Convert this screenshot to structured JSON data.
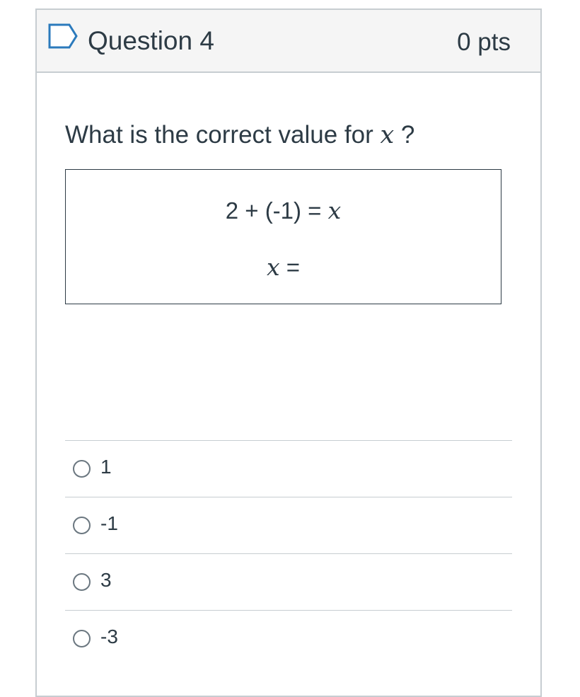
{
  "question": {
    "title": "Question 4",
    "points": "0 pts",
    "prompt_prefix": "What is the correct value for ",
    "prompt_variable": "x",
    "prompt_suffix": " ?",
    "equation_left": "2 + (-1) = ",
    "equation_variable": "x",
    "answer_variable": "x",
    "answer_equals": " ="
  },
  "answers": [
    {
      "label": "1"
    },
    {
      "label": "-1"
    },
    {
      "label": "3"
    },
    {
      "label": "-3"
    }
  ],
  "colors": {
    "text": "#2d3b45",
    "header_background": "#f5f5f5",
    "border": "#c7cdd1",
    "flag_outline": "#2b7abc",
    "radio_border": "#6b7780"
  },
  "icons": {
    "flag": "bookmark-flag-icon"
  }
}
